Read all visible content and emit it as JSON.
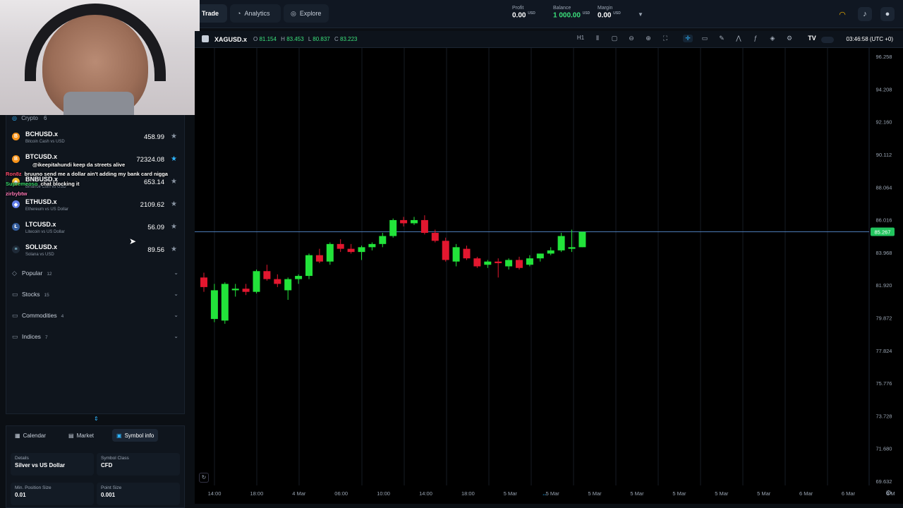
{
  "topbar": {
    "nav": [
      {
        "label": "Trade",
        "icon": "trade-icon"
      },
      {
        "label": "Analytics",
        "icon": "analytics-icon"
      },
      {
        "label": "Explore",
        "icon": "explore-icon"
      }
    ],
    "profit": {
      "label": "Profit",
      "value": "0.00",
      "currency": "USD"
    },
    "balance": {
      "label": "Balance",
      "value": "1 000.00",
      "currency": "USD"
    },
    "margin": {
      "label": "Margin",
      "value": "0.00",
      "currency": "USD"
    }
  },
  "sidebar": {
    "group_title": "Crypto",
    "group_count": "6",
    "symbols": [
      {
        "name": "BCHUSD.x",
        "desc": "Bitcoin Cash vs USD",
        "price": "458.99",
        "fav": false,
        "color": "#f7931a",
        "glyph": "B"
      },
      {
        "name": "BTCUSD.x",
        "desc": "",
        "price": "72324.08",
        "fav": true,
        "color": "#f7931a",
        "glyph": "B"
      },
      {
        "name": "BNBUSD.x",
        "desc": "Binance Coin vs USD",
        "price": "653.14",
        "fav": false,
        "color": "#f3ba2f",
        "glyph": "◆"
      },
      {
        "name": "ETHUSD.x",
        "desc": "Ethereum vs US Dollar",
        "price": "2109.62",
        "fav": false,
        "color": "#627eea",
        "glyph": "◆"
      },
      {
        "name": "LTCUSD.x",
        "desc": "Litecoin vs US Dollar",
        "price": "56.09",
        "fav": false,
        "color": "#345d9d",
        "glyph": "Ł"
      },
      {
        "name": "SOLUSD.x",
        "desc": "Solana vs USD",
        "price": "89.56",
        "fav": false,
        "color": "#1f2a37",
        "glyph": "≡"
      }
    ],
    "categories": [
      {
        "name": "Popular",
        "count": "12"
      },
      {
        "name": "Stocks",
        "count": "15"
      },
      {
        "name": "Commodities",
        "count": "4"
      },
      {
        "name": "Indices",
        "count": "7"
      }
    ]
  },
  "chat": [
    {
      "user": "",
      "text": "@ikeepitahundi keep da streets alive",
      "color": "#ff4d6d"
    },
    {
      "user": "Ron8z",
      "text": "bruuno send me a dollar ain't adding my bank card nigga",
      "color": "#ff4d6d"
    },
    {
      "user": "Supremeoso",
      "text": "chat blocking it",
      "color": "#38d96a"
    },
    {
      "user": "zirbybtw",
      "text": "",
      "color": "#ff7ab8"
    }
  ],
  "bottom_panel": {
    "tabs": [
      {
        "label": "Calendar",
        "active": false
      },
      {
        "label": "Market",
        "active": false
      },
      {
        "label": "Symbol info",
        "active": true
      }
    ],
    "info": [
      {
        "label": "Details",
        "value": "Silver vs US Dollar"
      },
      {
        "label": "Symbol Class",
        "value": "CFD"
      },
      {
        "label": "Min. Position Size",
        "value": "0.01"
      },
      {
        "label": "Point Size",
        "value": "0.001"
      }
    ]
  },
  "chart_header": {
    "symbol": "XAGUSD.x",
    "open_label": "O",
    "open": "81.154",
    "high_label": "H",
    "high": "83.453",
    "low_label": "L",
    "low": "80.837",
    "close_label": "C",
    "close": "83.223",
    "timeframe": "H1",
    "clock": "03:46:58 (UTC +0)"
  },
  "chart_data": {
    "type": "candlestick",
    "ylim": [
      69.632,
      96.258
    ],
    "y_ticks": [
      "96.258",
      "94.208",
      "92.160",
      "90.112",
      "88.064",
      "86.016",
      "83.968",
      "81.920",
      "79.872",
      "77.824",
      "75.776",
      "73.728",
      "71.680",
      "69.632"
    ],
    "x_ticks": [
      "14:00",
      "18:00",
      "4 Mar",
      "06:00",
      "10:00",
      "14:00",
      "18:00",
      "5 Mar",
      "5 Mar",
      "5 Mar",
      "5 Mar",
      "5 Mar",
      "5 Mar",
      "5 Mar",
      "6 Mar",
      "6 Mar",
      "6 M"
    ],
    "current_price": "85.267",
    "candles": [
      [
        82.4,
        82.7,
        81.5,
        81.8
      ],
      [
        79.8,
        82.0,
        79.6,
        81.6
      ],
      [
        79.7,
        82.1,
        79.5,
        82.0
      ],
      [
        81.6,
        82.0,
        81.2,
        81.7
      ],
      [
        81.7,
        82.0,
        81.3,
        81.5
      ],
      [
        81.5,
        82.9,
        81.4,
        82.8
      ],
      [
        82.8,
        83.2,
        82.2,
        82.3
      ],
      [
        82.3,
        82.6,
        81.8,
        82.0
      ],
      [
        81.6,
        82.4,
        81.0,
        82.3
      ],
      [
        82.3,
        82.6,
        82.0,
        82.5
      ],
      [
        82.5,
        83.9,
        82.3,
        83.8
      ],
      [
        83.8,
        84.2,
        83.3,
        83.4
      ],
      [
        83.4,
        84.6,
        83.2,
        84.5
      ],
      [
        84.5,
        84.8,
        84.0,
        84.2
      ],
      [
        84.2,
        84.5,
        83.9,
        84.0
      ],
      [
        84.0,
        84.4,
        83.5,
        84.3
      ],
      [
        84.3,
        84.6,
        84.1,
        84.5
      ],
      [
        84.5,
        85.2,
        84.3,
        85.0
      ],
      [
        85.0,
        86.1,
        84.9,
        86.0
      ],
      [
        86.0,
        86.2,
        85.6,
        85.8
      ],
      [
        85.8,
        86.2,
        85.7,
        86.0
      ],
      [
        86.0,
        86.3,
        85.1,
        85.2
      ],
      [
        85.2,
        85.4,
        84.6,
        84.7
      ],
      [
        84.7,
        84.9,
        83.4,
        83.5
      ],
      [
        83.4,
        84.5,
        83.1,
        84.3
      ],
      [
        84.2,
        84.4,
        83.5,
        83.6
      ],
      [
        83.6,
        83.7,
        83.0,
        83.1
      ],
      [
        83.2,
        83.5,
        83.0,
        83.4
      ],
      [
        83.4,
        83.6,
        82.4,
        83.3
      ],
      [
        83.1,
        83.6,
        82.9,
        83.5
      ],
      [
        83.5,
        83.7,
        82.9,
        83.0
      ],
      [
        83.2,
        83.8,
        83.1,
        83.6
      ],
      [
        83.6,
        83.9,
        83.4,
        83.9
      ],
      [
        83.9,
        84.3,
        83.8,
        84.1
      ],
      [
        84.1,
        85.2,
        84.0,
        85.0
      ],
      [
        84.2,
        85.4,
        84.0,
        84.3
      ],
      [
        84.3,
        85.0,
        84.3,
        85.267
      ]
    ]
  }
}
